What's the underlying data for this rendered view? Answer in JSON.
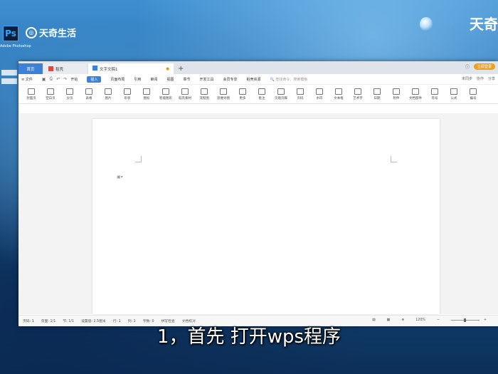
{
  "desktop": {
    "ps_icon_text": "Ps",
    "ps_label": "Adobe Photoshop",
    "watermark": "天奇生活",
    "brand_right": "天奇"
  },
  "window": {
    "tabs": [
      {
        "label": "首页"
      },
      {
        "label": "稻壳"
      },
      {
        "label": "文字文稿1"
      }
    ],
    "add_tab": "+",
    "login_label": "立即登录"
  },
  "menu": {
    "file": "文件",
    "items": [
      "开始",
      "插入",
      "页面布局",
      "引用",
      "审阅",
      "视图",
      "章节",
      "开发工具",
      "会员专享",
      "稻壳资源"
    ],
    "search_placeholder": "查找命令、搜索模板",
    "right": [
      "未同步",
      "协作",
      "分享"
    ]
  },
  "ribbon": [
    "封面页",
    "空白页",
    "分页",
    "表格",
    "图片",
    "形状",
    "图标",
    "智能图形",
    "稻壳素材",
    "流程图",
    "思维导图",
    "更多",
    "批注",
    "页眉页脚",
    "页码",
    "水印",
    "文本框",
    "艺术字",
    "日期",
    "附件",
    "文档部件",
    "符号",
    "公式",
    "编号"
  ],
  "status": {
    "page": "页码: 1",
    "pages": "页面: 1/1",
    "section": "节: 1/1",
    "settings": "设置值: 2.5厘米",
    "row": "行: 1",
    "col": "列: 1",
    "wordcount": "字数: 0",
    "spell": "拼写检查",
    "proof": "文档校对",
    "zoom": "120%"
  },
  "subtitle": "1，首先 打开wps程序"
}
